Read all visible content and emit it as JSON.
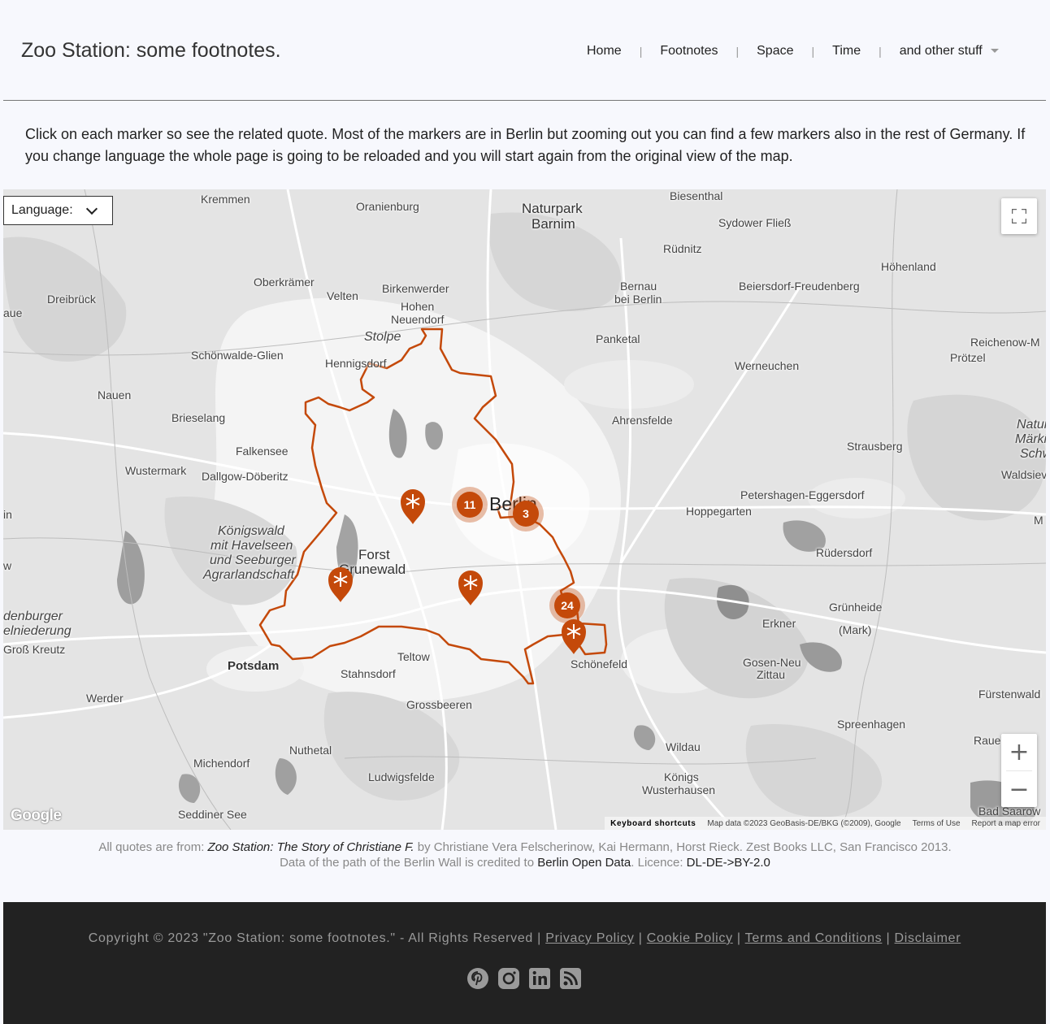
{
  "header": {
    "site_title": "Zoo Station: some footnotes.",
    "nav": [
      {
        "label": "Home"
      },
      {
        "label": "Footnotes"
      },
      {
        "label": "Space"
      },
      {
        "label": "Time"
      },
      {
        "label": "and other stuff"
      }
    ],
    "separator": "|"
  },
  "intro": "Click on each marker so see the related quote. Most of the markers are in Berlin but zooming out you can find a few markers also in the rest of Germany. If you change language the whole page is going to be reloaded and you will start again from the original view of the map.",
  "map": {
    "language_label": "Language:",
    "fullscreen_icon": "fullscreen-icon",
    "zoom_in": "+",
    "zoom_out": "−",
    "google_logo": "Google",
    "keyboard_shortcuts": "Keyboard shortcuts",
    "map_data": "Map data ©2023 GeoBasis-DE/BKG (©2009), Google",
    "terms": "Terms of Use",
    "report": "Report a map error",
    "accent_color": "#c4490a",
    "clusters": [
      {
        "count": "11"
      },
      {
        "count": "3"
      },
      {
        "count": "24"
      }
    ],
    "marker_icon": "asterisk-pin-icon",
    "places": {
      "kremmen": "Kremmen",
      "oranienburg": "Oranienburg",
      "naturpark1": "Naturpark",
      "naturpark2": "Barnim",
      "biesenthal": "Biesenthal",
      "sydower": "Sydower Fließ",
      "rudnitz": "Rüdnitz",
      "hohenland": "Höhenland",
      "oberkramer": "Oberkrämer",
      "velten": "Velten",
      "birkenwerder": "Birkenwerder",
      "hohen": "Hohen",
      "neuendorf": "Neuendorf",
      "bernau1": "Bernau",
      "bernau2": "bei Berlin",
      "beiersdorf": "Beiersdorf-Freudenberg",
      "dreibruck": "Dreibrück",
      "aue": "aue",
      "stolpe": "Stolpe",
      "panketal": "Panketal",
      "reichenow": "Reichenow-M",
      "schonwalde": "Schönwalde-Glien",
      "hennigsdorf": "Hennigsdorf",
      "werneuchen": "Werneuchen",
      "protzel": "Prötzel",
      "nauen": "Nauen",
      "brieselang": "Brieselang",
      "ahrensfelde": "Ahrensfelde",
      "naturp3": "Naturp",
      "markis": "Märkis",
      "schwe": "Schwe",
      "falkensee": "Falkensee",
      "strausberg": "Strausberg",
      "wustermark": "Wustermark",
      "dallgow": "Dallgow-Döberitz",
      "waldsievers": "Waldsievers",
      "berlin": "Berlin",
      "petershagen": "Petershagen-Eggersdorf",
      "in": "in",
      "m": "M",
      "hoppegarten": "Hoppegarten",
      "konigswald1": "Königswald",
      "konigswald2": "mit Havelseen",
      "konigswald3": "und Seeburger",
      "konigswald4": "Agrarlandschaft",
      "forst1": "Forst",
      "forst2": "Grunewald",
      "rudersdorf": "Rüdersdorf",
      "w": "w",
      "denburger": "denburger",
      "elniederung": "elniederung",
      "gruneheide1": "Grünheide",
      "gruneheide2": "(Mark)",
      "erkner": "Erkner",
      "grosskreutz": "Groß Kreutz",
      "teltow": "Teltow",
      "potsdam": "Potsdam",
      "stahnsdorf": "Stahnsdorf",
      "schonefeld": "Schönefeld",
      "gosen1": "Gosen-Neu",
      "gosen2": "Zittau",
      "werder": "Werder",
      "furstenwalde": "Fürstenwald",
      "grossbeeren": "Grossbeeren",
      "spreenhagen": "Spreenhagen",
      "nuthetal": "Nuthetal",
      "wildau": "Wildau",
      "raue": "Raue",
      "michendorf": "Michendorf",
      "ludwigsfelde": "Ludwigsfelde",
      "konigs1": "Königs",
      "konigs2": "Wusterhausen",
      "seddiner": "Seddiner See",
      "badsaarow": "Bad Saarow"
    }
  },
  "credits": {
    "line1_prefix": "All quotes are from: ",
    "book_title": "Zoo Station: The Story of Christiane F.",
    "line1_suffix": " by Christiane Vera Felscherinow, Kai Hermann, Horst Rieck. Zest Books LLC, San Francisco 2013.",
    "line2_prefix": "Data of the path of the Berlin Wall is credited to ",
    "source_link": "Berlin Open Data",
    "line2_mid": ". Licence: ",
    "licence": "DL-DE->BY-2.0"
  },
  "footer": {
    "copyright": "Copyright © 2023 \"Zoo Station: some footnotes.\" - All Rights Reserved |",
    "links": [
      {
        "label": "Privacy Policy"
      },
      {
        "label": "Cookie Policy"
      },
      {
        "label": "Terms and Conditions"
      },
      {
        "label": "Disclaimer"
      }
    ],
    "social_icons": [
      "pinterest-icon",
      "instagram-icon",
      "linkedin-icon",
      "rss-icon"
    ]
  }
}
